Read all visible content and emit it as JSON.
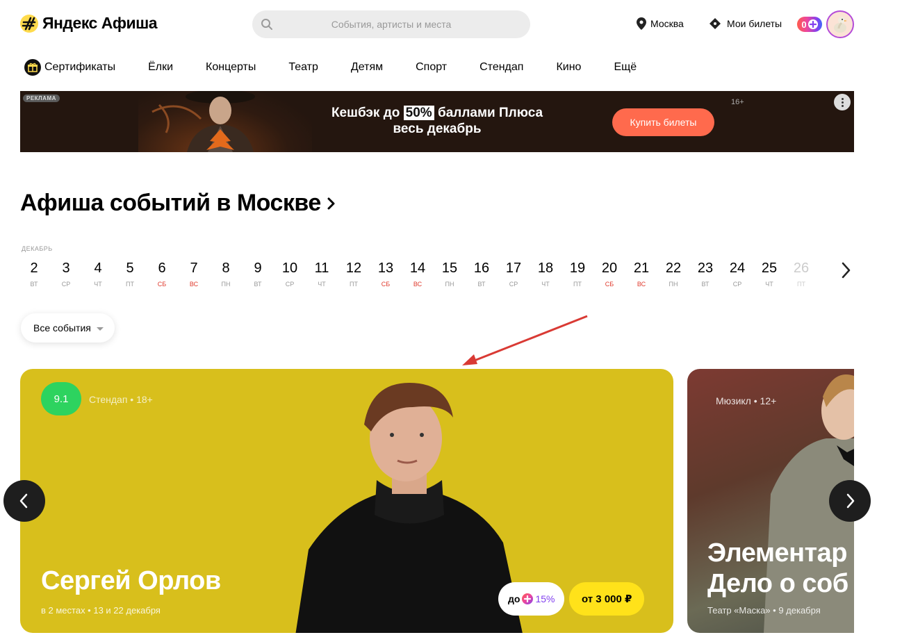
{
  "header": {
    "logo_text": "Яндекс Афиша",
    "search_placeholder": "События, артисты и места",
    "city": "Москва",
    "tickets_label": "Мои билеты",
    "plus_count": "0"
  },
  "nav": {
    "items": [
      {
        "label": "Сертификаты",
        "icon": "gift-icon"
      },
      {
        "label": "Ёлки"
      },
      {
        "label": "Концерты"
      },
      {
        "label": "Театр"
      },
      {
        "label": "Детям"
      },
      {
        "label": "Спорт"
      },
      {
        "label": "Стендап"
      },
      {
        "label": "Кино"
      },
      {
        "label": "Ещё"
      }
    ]
  },
  "banner": {
    "ad_label": "РЕКЛАМА",
    "text_before": "Кешбэк до",
    "highlight": "50%",
    "text_after": "баллами Плюса",
    "line2": "весь декабрь",
    "button": "Купить билеты",
    "age": "16+"
  },
  "page_title": "Афиша событий в Москве",
  "calendar": {
    "month": "ДЕКАБРЬ",
    "days": [
      {
        "num": "2",
        "dow": "вт",
        "weekend": false
      },
      {
        "num": "3",
        "dow": "ср",
        "weekend": false
      },
      {
        "num": "4",
        "dow": "чт",
        "weekend": false
      },
      {
        "num": "5",
        "dow": "пт",
        "weekend": false
      },
      {
        "num": "6",
        "dow": "сб",
        "weekend": true
      },
      {
        "num": "7",
        "dow": "вс",
        "weekend": true
      },
      {
        "num": "8",
        "dow": "пн",
        "weekend": false
      },
      {
        "num": "9",
        "dow": "вт",
        "weekend": false
      },
      {
        "num": "10",
        "dow": "ср",
        "weekend": false
      },
      {
        "num": "11",
        "dow": "чт",
        "weekend": false
      },
      {
        "num": "12",
        "dow": "пт",
        "weekend": false
      },
      {
        "num": "13",
        "dow": "сб",
        "weekend": true
      },
      {
        "num": "14",
        "dow": "вс",
        "weekend": true
      },
      {
        "num": "15",
        "dow": "пн",
        "weekend": false
      },
      {
        "num": "16",
        "dow": "вт",
        "weekend": false
      },
      {
        "num": "17",
        "dow": "ср",
        "weekend": false
      },
      {
        "num": "18",
        "dow": "чт",
        "weekend": false
      },
      {
        "num": "19",
        "dow": "пт",
        "weekend": false
      },
      {
        "num": "20",
        "dow": "сб",
        "weekend": true
      },
      {
        "num": "21",
        "dow": "вс",
        "weekend": true
      },
      {
        "num": "22",
        "dow": "пн",
        "weekend": false
      },
      {
        "num": "23",
        "dow": "вт",
        "weekend": false
      },
      {
        "num": "24",
        "dow": "ср",
        "weekend": false
      },
      {
        "num": "25",
        "dow": "чт",
        "weekend": false
      },
      {
        "num": "26",
        "dow": "пт",
        "weekend": false,
        "faded": true
      }
    ]
  },
  "filter": {
    "label": "Все события"
  },
  "cards": {
    "main": {
      "rating": "9.1",
      "genre": "Стендап",
      "age": "18+",
      "title": "Сергей Орлов",
      "subtitle": "в 2 местах • 13 и 22 декабря",
      "cashback_prefix": "до",
      "cashback_pct": "15%",
      "price": "от 3 000 ₽",
      "bg_color": "#d8bf1c"
    },
    "second": {
      "genre": "Мюзикл",
      "age": "12+",
      "title_line1": "Элементар",
      "title_line2": "Дело о соб",
      "subtitle": "Театр «Маска» • 9 декабря"
    }
  },
  "colors": {
    "accent_yellow": "#ffdb4d",
    "banner_button": "#ff6a4d",
    "weekend": "#e03a2d",
    "rating_green": "#2dd35f",
    "price_yellow": "#ffe21a"
  }
}
